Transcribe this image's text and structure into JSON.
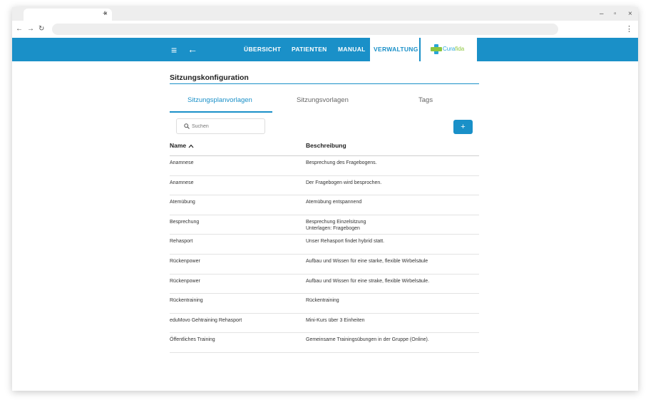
{
  "browser": {
    "tab_close": "×",
    "new_tab": "+",
    "window_controls": {
      "minimize": "–",
      "restore": "▫",
      "close": "×"
    },
    "nav": {
      "back": "←",
      "forward": "→",
      "reload": "↻"
    },
    "menu": "⋮"
  },
  "appbar": {
    "menu_icon": "≡",
    "back_icon": "←",
    "nav_items": [
      {
        "label": "ÜBERSICHT",
        "active": false
      },
      {
        "label": "PATIENTEN",
        "active": false
      },
      {
        "label": "MANUAL",
        "active": false
      },
      {
        "label": "VERWALTUNG",
        "active": true
      }
    ],
    "logo": {
      "text_a": "Cura",
      "text_b": "fida"
    },
    "colors": {
      "bar": "#1a90c8",
      "logo_blue": "#27a5d8",
      "logo_green": "#8cc63f"
    }
  },
  "page": {
    "title": "Sitzungskonfiguration",
    "tabs": [
      {
        "label": "Sitzungsplanvorlagen",
        "active": true
      },
      {
        "label": "Sitzungsvorlagen",
        "active": false
      },
      {
        "label": "Tags",
        "active": false
      }
    ],
    "search": {
      "placeholder": "Suchen",
      "value": ""
    },
    "add_button": "+"
  },
  "table": {
    "columns": [
      "Name",
      "Beschreibung"
    ],
    "sort": {
      "column": "Name",
      "direction": "asc"
    },
    "rows": [
      {
        "name": "Anamnese",
        "description": [
          "Besprechung des Fragebogens."
        ]
      },
      {
        "name": "Anamnese",
        "description": [
          "Der Fragebogen wird besprochen."
        ]
      },
      {
        "name": "Atemübung",
        "description": [
          "Atemübung entspannend"
        ]
      },
      {
        "name": "Besprechung",
        "description": [
          "Besprechung Einzelsitzung",
          "Unterlagen: Fragebogen"
        ]
      },
      {
        "name": "Rehasport",
        "description": [
          "Unser Rehasport findet hybrid statt."
        ]
      },
      {
        "name": "Rückenpower",
        "description": [
          "Aufbau und Wissen für eine starke, flexible Wirbelsäule"
        ]
      },
      {
        "name": "Rückenpower",
        "description": [
          "Aufbau und Wissen für eine strake, flexible Wirbelsäule."
        ]
      },
      {
        "name": "Rückentraining",
        "description": [
          "Rückentraining"
        ]
      },
      {
        "name": "eduMovo Gehtraining Rehasport",
        "description": [
          "Mini-Kurs über 3 Einheiten"
        ]
      },
      {
        "name": "Öffentliches Training",
        "description": [
          "Gemeinsame Trainingsübungen in der Gruppe (Online)."
        ]
      }
    ]
  }
}
